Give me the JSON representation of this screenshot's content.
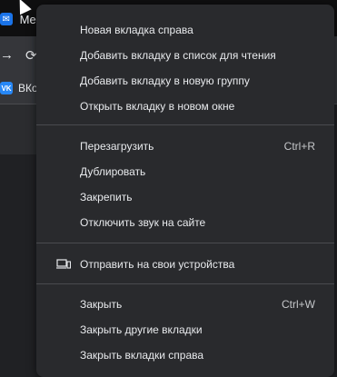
{
  "background": {
    "tab_title": "Мессе",
    "bookmark_label": "ВКо",
    "bookmark_icon_text": "VK"
  },
  "menu": {
    "group1": [
      {
        "label": "Новая вкладка справа"
      },
      {
        "label": "Добавить вкладку в список для чтения"
      },
      {
        "label": "Добавить вкладку в новую группу"
      },
      {
        "label": "Открыть вкладку в новом окне"
      }
    ],
    "group2": [
      {
        "label": "Перезагрузить",
        "shortcut": "Ctrl+R"
      },
      {
        "label": "Дублировать"
      },
      {
        "label": "Закрепить"
      },
      {
        "label": "Отключить звук на сайте"
      }
    ],
    "group3": [
      {
        "label": "Отправить на свои устройства",
        "icon": "devices-icon"
      }
    ],
    "group4": [
      {
        "label": "Закрыть",
        "shortcut": "Ctrl+W"
      },
      {
        "label": "Закрыть другие вкладки"
      },
      {
        "label": "Закрыть вкладки справа"
      }
    ]
  }
}
